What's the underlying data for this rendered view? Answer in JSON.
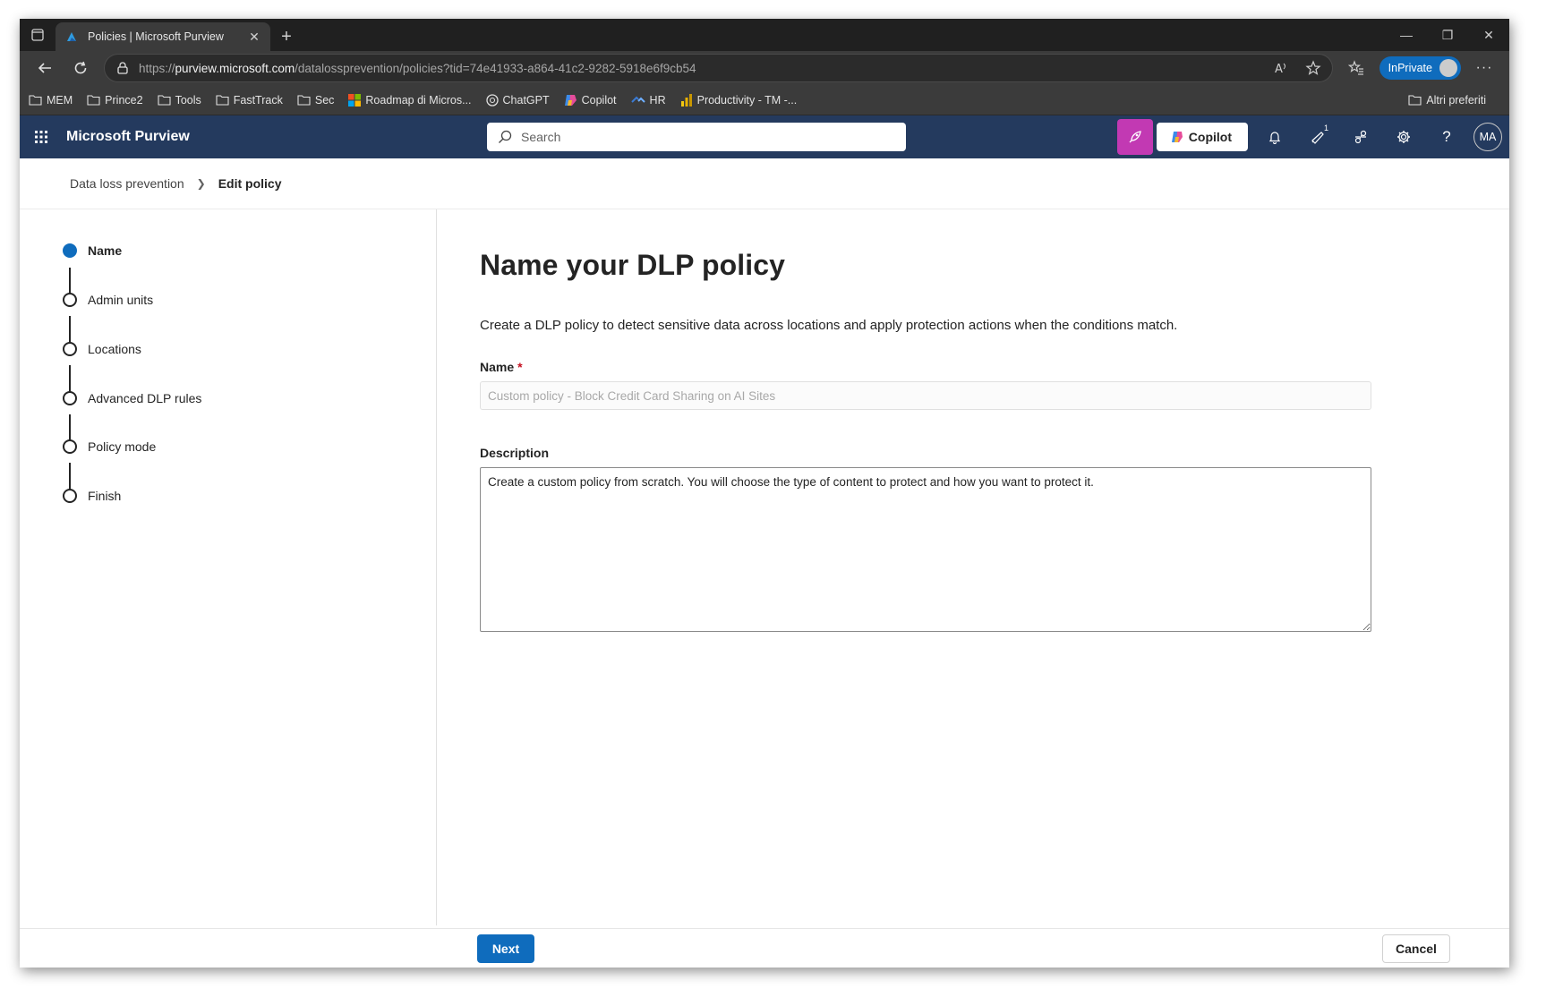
{
  "browser": {
    "tab_title": "Policies | Microsoft Purview",
    "url_prefix": "https://",
    "url_host": "purview.microsoft.com",
    "url_path": "/datalossprevention/policies?tid=74e41933-a864-41c2-9282-5918e6f9cb54",
    "inprivate_label": "InPrivate"
  },
  "favorites": {
    "items": [
      {
        "label": "MEM",
        "icon": "folder-icon"
      },
      {
        "label": "Prince2",
        "icon": "folder-icon"
      },
      {
        "label": "Tools",
        "icon": "folder-icon"
      },
      {
        "label": "FastTrack",
        "icon": "folder-icon"
      },
      {
        "label": "Sec",
        "icon": "folder-icon"
      },
      {
        "label": "Roadmap di Micros...",
        "icon": "microsoft-logo-icon"
      },
      {
        "label": "ChatGPT",
        "icon": "chatgpt-icon"
      },
      {
        "label": "Copilot",
        "icon": "copilot-icon"
      },
      {
        "label": "HR",
        "icon": "hr-icon"
      },
      {
        "label": "Productivity - TM -...",
        "icon": "powerbi-icon"
      }
    ],
    "other_favorites": "Altri preferiti"
  },
  "header": {
    "app_title": "Microsoft Purview",
    "search_placeholder": "Search",
    "copilot_label": "Copilot",
    "notification_badge": "1",
    "avatar_initials": "MA"
  },
  "breadcrumb": {
    "parent": "Data loss prevention",
    "current": "Edit policy"
  },
  "steps": [
    {
      "label": "Name",
      "active": true
    },
    {
      "label": "Admin units",
      "active": false
    },
    {
      "label": "Locations",
      "active": false
    },
    {
      "label": "Advanced DLP rules",
      "active": false
    },
    {
      "label": "Policy mode",
      "active": false
    },
    {
      "label": "Finish",
      "active": false
    }
  ],
  "form": {
    "title": "Name your DLP policy",
    "description": "Create a DLP policy to detect sensitive data across locations and apply protection actions when the conditions match.",
    "name_label": "Name",
    "name_required": "*",
    "name_value": "",
    "name_placeholder": "Custom policy - Block Credit Card Sharing on AI Sites",
    "description_label": "Description",
    "description_value": "Create a custom policy from scratch. You will choose the type of content to protect and how you want to protect it."
  },
  "footer": {
    "next_label": "Next",
    "cancel_label": "Cancel"
  },
  "colors": {
    "header_bg": "#243a5e",
    "accent": "#0f6cbd",
    "copilot_pink": "#c239b3"
  }
}
